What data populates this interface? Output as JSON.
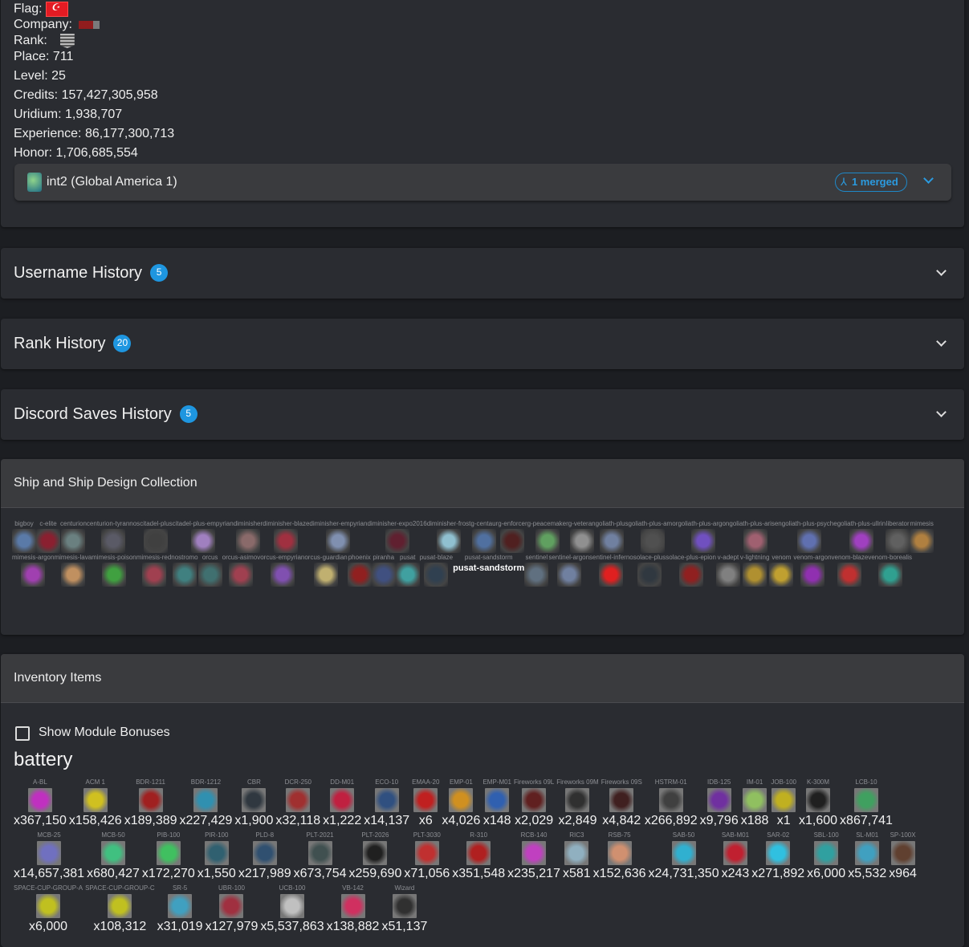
{
  "profile": {
    "flag_label": "Flag:",
    "company_label": "Company:",
    "rank_label": "Rank:",
    "place": "Place: 711",
    "level": "Level: 25",
    "credits": "Credits: 157,427,305,958",
    "uridium": "Uridium: 1,938,707",
    "experience": "Experience: 86,177,300,713",
    "honor": "Honor: 1,706,685,554",
    "server": {
      "name": "int2 (Global America 1)",
      "merged": "1 merged"
    }
  },
  "accordions": [
    {
      "title": "Username History",
      "count": "5"
    },
    {
      "title": "Rank History",
      "count": "20"
    },
    {
      "title": "Discord Saves History",
      "count": "5"
    }
  ],
  "ships": {
    "title": "Ship and Ship Design Collection",
    "items": [
      {
        "name": "bigboy",
        "color": "#5a7aa8"
      },
      {
        "name": "c-elite",
        "color": "#8a2030"
      },
      {
        "name": "centurion",
        "color": "#6a8080"
      },
      {
        "name": "centurion-tyrannos",
        "color": "#5a5a66"
      },
      {
        "name": "citadel-plus",
        "color": "#404040"
      },
      {
        "name": "citadel-plus-empyrian",
        "color": "#a080c0"
      },
      {
        "name": "diminisher",
        "color": "#8a6a6a"
      },
      {
        "name": "diminisher-blaze",
        "color": "#a03040"
      },
      {
        "name": "diminisher-empyrian",
        "color": "#8090b0"
      },
      {
        "name": "diminisher-expo2016",
        "color": "#602030"
      },
      {
        "name": "diminisher-frost",
        "color": "#90c0d0"
      },
      {
        "name": "g-centaur",
        "color": "#5070a0"
      },
      {
        "name": "g-enforcer",
        "color": "#502020"
      },
      {
        "name": "g-peacemaker",
        "color": "#60a060"
      },
      {
        "name": "g-veteran",
        "color": "#909090"
      },
      {
        "name": "goliath-plus",
        "color": "#7080a0"
      },
      {
        "name": "goliath-plus-amor",
        "color": "#505050"
      },
      {
        "name": "goliath-plus-argon",
        "color": "#7050c0"
      },
      {
        "name": "goliath-plus-arisen",
        "color": "#a06070"
      },
      {
        "name": "goliath-plus-psyche",
        "color": "#6070b0"
      },
      {
        "name": "goliath-plus-ullrin",
        "color": "#a040c0"
      },
      {
        "name": "liberator",
        "color": "#606060"
      },
      {
        "name": "mimesis",
        "color": "#b08040"
      },
      {
        "name": "mimesis-argon",
        "color": "#a040b0"
      },
      {
        "name": "mimesis-lava",
        "color": "#c09060"
      },
      {
        "name": "mimesis-poison",
        "color": "#40a040"
      },
      {
        "name": "mimesis-red",
        "color": "#a04050"
      },
      {
        "name": "nostromo",
        "color": "#408080"
      },
      {
        "name": "orcus",
        "color": "#407070"
      },
      {
        "name": "orcus-asimov",
        "color": "#a04050"
      },
      {
        "name": "orcus-empyrian",
        "color": "#8050b0"
      },
      {
        "name": "orcus-guardian",
        "color": "#c0b070"
      },
      {
        "name": "phoenix",
        "color": "#902020"
      },
      {
        "name": "piranha",
        "color": "#405080"
      },
      {
        "name": "pusat",
        "color": "#40a0a0"
      },
      {
        "name": "pusat-blaze",
        "color": "#304050"
      },
      {
        "name": "pusat-sandstorm",
        "color": "",
        "broken": true
      },
      {
        "name": "sentinel",
        "color": "#607080"
      },
      {
        "name": "sentinel-argon",
        "color": "#7080a0"
      },
      {
        "name": "sentinel-inferno",
        "color": "#e02020"
      },
      {
        "name": "solace-plus",
        "color": "#303840"
      },
      {
        "name": "solace-plus-epion",
        "color": "#902020"
      },
      {
        "name": "v-adept",
        "color": "#808080"
      },
      {
        "name": "v-lightning",
        "color": "#b09030"
      },
      {
        "name": "venom",
        "color": "#c0a030"
      },
      {
        "name": "venom-argon",
        "color": "#9030b0"
      },
      {
        "name": "venom-blaze",
        "color": "#c03030"
      },
      {
        "name": "venom-borealis",
        "color": "#30a090"
      }
    ]
  },
  "inventory": {
    "title": "Inventory Items",
    "show_module_bonuses": "Show Module Bonuses",
    "category": "battery",
    "items": [
      {
        "name": "A-BL",
        "count": "x367,150",
        "color": "#c030c0"
      },
      {
        "name": "ACM 1",
        "count": "x158,426",
        "color": "#d0c020"
      },
      {
        "name": "BDR-1211",
        "count": "x189,389",
        "color": "#a02020"
      },
      {
        "name": "BDR-1212",
        "count": "x227,429",
        "color": "#3090b0"
      },
      {
        "name": "CBR",
        "count": "x1,900",
        "color": "#303840"
      },
      {
        "name": "DCR-250",
        "count": "x32,118",
        "color": "#a03030"
      },
      {
        "name": "DD-M01",
        "count": "x1,222",
        "color": "#c02040"
      },
      {
        "name": "ECO-10",
        "count": "x14,137",
        "color": "#305080"
      },
      {
        "name": "EMAA-20",
        "count": "x6",
        "color": "#c02020"
      },
      {
        "name": "EMP-01",
        "count": "x4,026",
        "color": "#d09020"
      },
      {
        "name": "EMP-M01",
        "count": "x148",
        "color": "#3060b0"
      },
      {
        "name": "Fireworks 09L",
        "count": "x2,029",
        "color": "#602020"
      },
      {
        "name": "Fireworks 09M",
        "count": "x2,849",
        "color": "#303030"
      },
      {
        "name": "Fireworks 09S",
        "count": "x4,842",
        "color": "#402020"
      },
      {
        "name": "HSTRM-01",
        "count": "x266,892",
        "color": "#404040"
      },
      {
        "name": "IDB-125",
        "count": "x9,796",
        "color": "#7030a0"
      },
      {
        "name": "IM-01",
        "count": "x188",
        "color": "#90c060"
      },
      {
        "name": "JOB-100",
        "count": "x1",
        "color": "#c0b020"
      },
      {
        "name": "K-300M",
        "count": "x1,600",
        "color": "#202020"
      },
      {
        "name": "LCB-10",
        "count": "x867,741",
        "color": "#40a060"
      },
      {
        "name": "MCB-25",
        "count": "x14,657,381",
        "color": "#7070c0"
      },
      {
        "name": "MCB-50",
        "count": "x680,427",
        "color": "#40c080"
      },
      {
        "name": "PIB-100",
        "count": "x172,270",
        "color": "#40c060"
      },
      {
        "name": "PIR-100",
        "count": "x1,550",
        "color": "#306070"
      },
      {
        "name": "PLD-8",
        "count": "x217,989",
        "color": "#305070"
      },
      {
        "name": "PLT-2021",
        "count": "x673,754",
        "color": "#405050"
      },
      {
        "name": "PLT-2026",
        "count": "x259,690",
        "color": "#202020"
      },
      {
        "name": "PLT-3030",
        "count": "x71,056",
        "color": "#c03030"
      },
      {
        "name": "R-310",
        "count": "x351,548",
        "color": "#b02020"
      },
      {
        "name": "RCB-140",
        "count": "x235,217",
        "color": "#c040c0"
      },
      {
        "name": "RIC3",
        "count": "x581",
        "color": "#90b0c0"
      },
      {
        "name": "RSB-75",
        "count": "x152,636",
        "color": "#d09070"
      },
      {
        "name": "SAB-50",
        "count": "x24,731,350",
        "color": "#30b0d0"
      },
      {
        "name": "SAB-M01",
        "count": "x243",
        "color": "#c02030"
      },
      {
        "name": "SAR-02",
        "count": "x271,892",
        "color": "#30c0e0"
      },
      {
        "name": "SBL-100",
        "count": "x6,000",
        "color": "#30a0a0"
      },
      {
        "name": "SL-M01",
        "count": "x5,532",
        "color": "#40a0c0"
      },
      {
        "name": "SP-100X",
        "count": "x964",
        "color": "#604030"
      },
      {
        "name": "SPACE-CUP-GROUP-A",
        "count": "x6,000",
        "color": "#c0c020"
      },
      {
        "name": "SPACE-CUP-GROUP-C",
        "count": "x108,312",
        "color": "#c0c020"
      },
      {
        "name": "SR-5",
        "count": "x31,019",
        "color": "#40a0c0"
      },
      {
        "name": "UBR-100",
        "count": "x127,979",
        "color": "#a03040"
      },
      {
        "name": "UCB-100",
        "count": "x5,537,863",
        "color": "#c0c0c0"
      },
      {
        "name": "VB-142",
        "count": "x138,882",
        "color": "#d03060"
      },
      {
        "name": "Wizard",
        "count": "x51,137",
        "color": "#303030"
      }
    ]
  }
}
